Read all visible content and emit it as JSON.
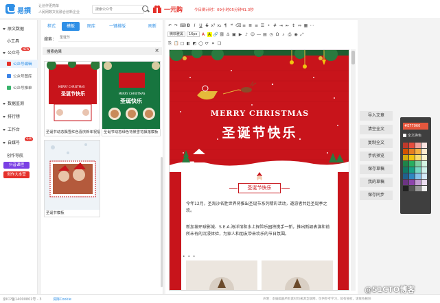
{
  "header": {
    "logo_text": "易撰",
    "tagline1": "让创作更简单",
    "tagline2": "人民网数文化融合创新企业",
    "search_placeholder": "搜索公众号",
    "promo_text": "一元购",
    "countdown": "今日倒计时：09小时05分钟41.3秒"
  },
  "leftnav": {
    "items": [
      {
        "label": "原文数据",
        "arrow": true
      },
      {
        "label": "小工具",
        "arrow": false
      },
      {
        "label": "公众号",
        "arrow": true,
        "badge": "NEW"
      },
      {
        "label": "数据监测",
        "arrow": true
      },
      {
        "label": "排行榜",
        "arrow": true
      },
      {
        "label": "工作台",
        "arrow": true
      },
      {
        "label": "自媒号",
        "arrow": true,
        "badge": "免费"
      },
      {
        "label": "创作导航",
        "arrow": false
      }
    ],
    "sub_items": [
      {
        "label": "公众号编辑",
        "color": "#e5302a"
      },
      {
        "label": "公众号图库",
        "color": "#3d84e6"
      },
      {
        "label": "公众号推单",
        "color": "#38b36b"
      }
    ],
    "promo_buttons": [
      {
        "label": "抖音课程",
        "color": "#7a3fe4"
      },
      {
        "label": "创作大本营",
        "color": "#e5302a"
      }
    ]
  },
  "tpl_panel": {
    "tabs": [
      "样式",
      "模板",
      "图库",
      "一键排版",
      "刷新"
    ],
    "search_label": "搜索：",
    "search_placeholder": "圣诞节",
    "results_label": "搜索结果",
    "close": "×",
    "thumbs": [
      {
        "caption": "圣诞节动态飘雪红色喜庆新年祝福"
      },
      {
        "caption": "圣诞节动态绿色背景雪花飘落模板"
      },
      {
        "caption": "圣诞节模板"
      }
    ],
    "thumb_heading1": "圣诞节快乐",
    "thumb_heading2": "圣诞快乐",
    "thumb_merry": "MERRY CHRISTMAS"
  },
  "editor": {
    "font_select": "微软雅黑",
    "size_select": "16px",
    "merry": "MERRY CHRISTMAS",
    "title_cn": "圣诞节快乐",
    "section_title": "圣诞节快乐",
    "para1": "今年12月，圣淘沙名胜世界将推出圣诞节系列精彩活动，邀游者共赴圣诞季之欢。",
    "para2": "新加坡环球影城、S.E.A.海洋馆和水上探险乐园将携手一新，推出新颖表演和前所未有的沉浸体验，为家人和朋友带来欢乐的节日氛围。"
  },
  "actions": [
    "导入文章",
    "清空全文",
    "复制全文",
    "手机预览",
    "保存草稿",
    "我的草稿",
    "保存同步"
  ],
  "color_panel": {
    "hex": "#E77060",
    "all_label": "全文换色",
    "colors": [
      "#c0392b",
      "#e74c3c",
      "#f1a09a",
      "#fbe3e0",
      "#d35400",
      "#e67e22",
      "#f5b041",
      "#fdebd0",
      "#d4ac0d",
      "#f1c40f",
      "#f7dc6f",
      "#fcf3cf",
      "#1e8449",
      "#27ae60",
      "#7dcea0",
      "#d5f5e3",
      "#117a65",
      "#16a085",
      "#76d7c4",
      "#d1f2eb",
      "#1f618d",
      "#2e86c1",
      "#85c1e9",
      "#d6eaf8",
      "#6c3483",
      "#8e44ad",
      "#c39bd3",
      "#ebdef0",
      "#212121",
      "#555555",
      "#999999",
      "#eeeeee"
    ]
  },
  "footer": {
    "left": "京ICP备14000801号 - 3",
    "cookie": "清除Cookie",
    "note": "声明：本编辑器所有素材均来源互联网，仅供参考学习，如有侵权，请联系删除"
  },
  "watermark": "@51CTO博客"
}
